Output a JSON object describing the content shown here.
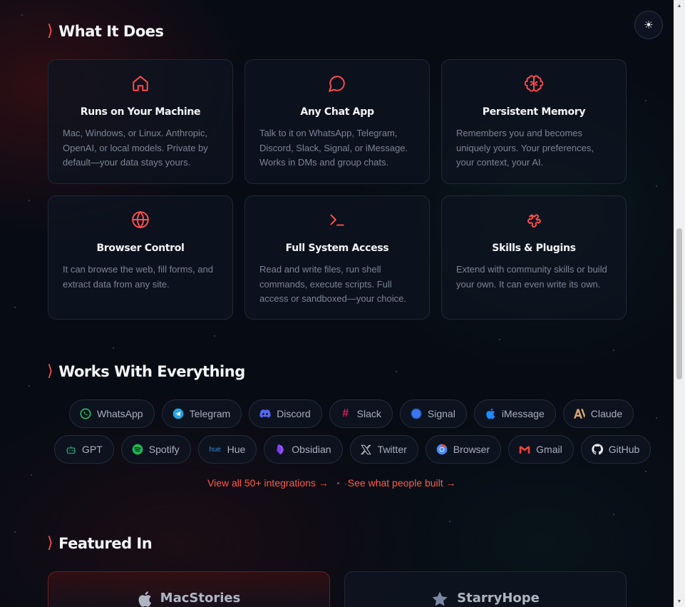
{
  "sections": {
    "what_it_does": "What It Does",
    "works_with": "Works With Everything",
    "featured_in": "Featured In"
  },
  "features": [
    {
      "icon": "home-icon",
      "title": "Runs on Your Machine",
      "desc": "Mac, Windows, or Linux. Anthropic, OpenAI, or local models. Private by default—your data stays yours."
    },
    {
      "icon": "chat-bubble-icon",
      "title": "Any Chat App",
      "desc": "Talk to it on WhatsApp, Telegram, Discord, Slack, Signal, or iMessage. Works in DMs and group chats."
    },
    {
      "icon": "brain-icon",
      "title": "Persistent Memory",
      "desc": "Remembers you and becomes uniquely yours. Your preferences, your context, your AI."
    },
    {
      "icon": "globe-icon",
      "title": "Browser Control",
      "desc": "It can browse the web, fill forms, and extract data from any site."
    },
    {
      "icon": "terminal-icon",
      "title": "Full System Access",
      "desc": "Read and write files, run shell commands, execute scripts. Full access or sandboxed—your choice."
    },
    {
      "icon": "puzzle-icon",
      "title": "Skills & Plugins",
      "desc": "Extend with community skills or build your own. It can even write its own."
    }
  ],
  "integrations_row1": [
    "WhatsApp",
    "Telegram",
    "Discord",
    "Slack",
    "Signal",
    "iMessage",
    "Claude"
  ],
  "integrations_row2": [
    "GPT",
    "Spotify",
    "Hue",
    "Obsidian",
    "Twitter",
    "Browser",
    "Gmail",
    "GitHub"
  ],
  "hue_icon_text": "hue",
  "links": {
    "integrations": "View all 50+ integrations →",
    "showcase": "See what people built →"
  },
  "featured": [
    "MacStories",
    "StarryHope"
  ],
  "theme_toggle_icon": "sun-icon",
  "colors": {
    "accent": "#ff4d4d",
    "background": "#070b14",
    "whatsapp": "#25d366",
    "telegram": "#2aa3df",
    "discord": "#5865f2",
    "slack": "#e01e5a",
    "signal": "#3a76f0",
    "imessage": "#1a8cff",
    "claude": "#d9a774",
    "gpt": "#10a37f",
    "spotify": "#1db954",
    "hue": "#2f8fe0",
    "obsidian": "#7c3aed",
    "gmail": "#ea4335"
  }
}
